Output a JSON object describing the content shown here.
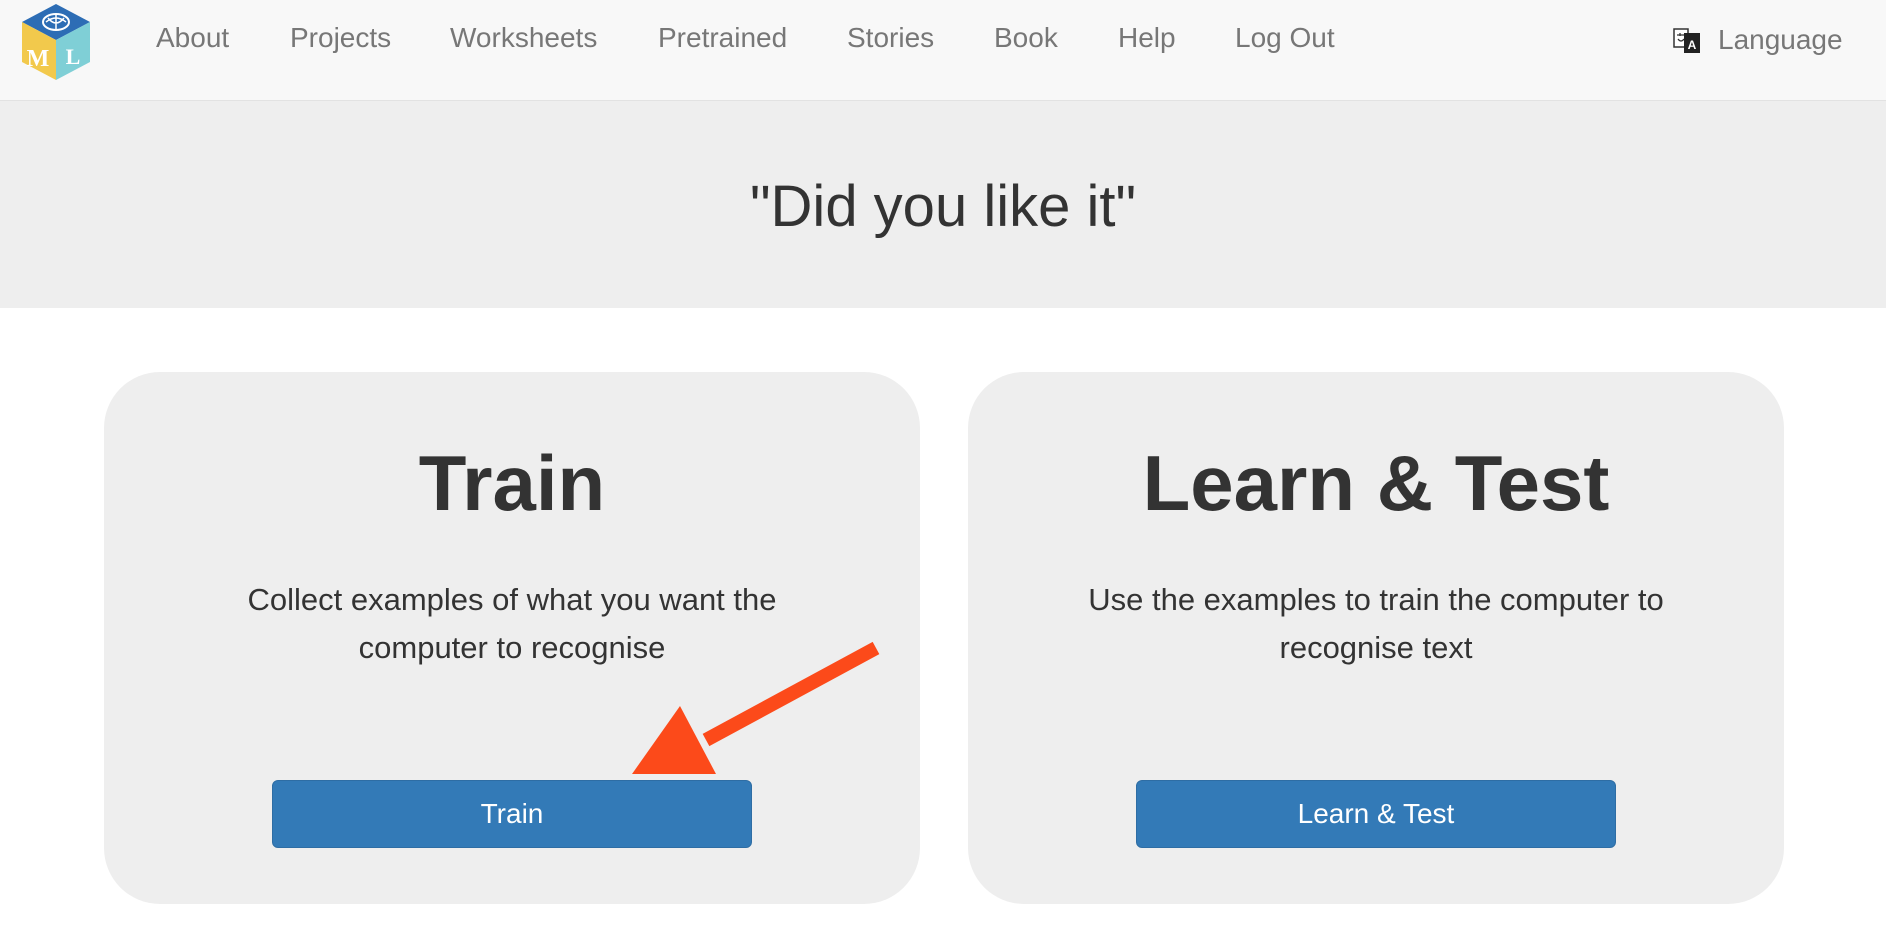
{
  "nav": {
    "items": [
      "About",
      "Projects",
      "Worksheets",
      "Pretrained",
      "Stories",
      "Book",
      "Help",
      "Log Out"
    ],
    "language_label": "Language",
    "language_icon": "translate-icon",
    "logo_letters": [
      "M",
      "L"
    ]
  },
  "header": {
    "title": "\"Did you like it\""
  },
  "cards": [
    {
      "title": "Train",
      "description": "Collect examples of what you want the computer to recognise",
      "button_label": "Train"
    },
    {
      "title": "Learn & Test",
      "description": "Use the examples to train the computer to recognise text",
      "button_label": "Learn & Test"
    }
  ],
  "colors": {
    "navbar_bg": "#f8f8f8",
    "nav_text": "#777777",
    "jumbotron_bg": "#eeeeee",
    "card_bg": "#eeeeee",
    "button_primary": "#337ab7",
    "annotation_arrow": "#fc4a1a"
  }
}
